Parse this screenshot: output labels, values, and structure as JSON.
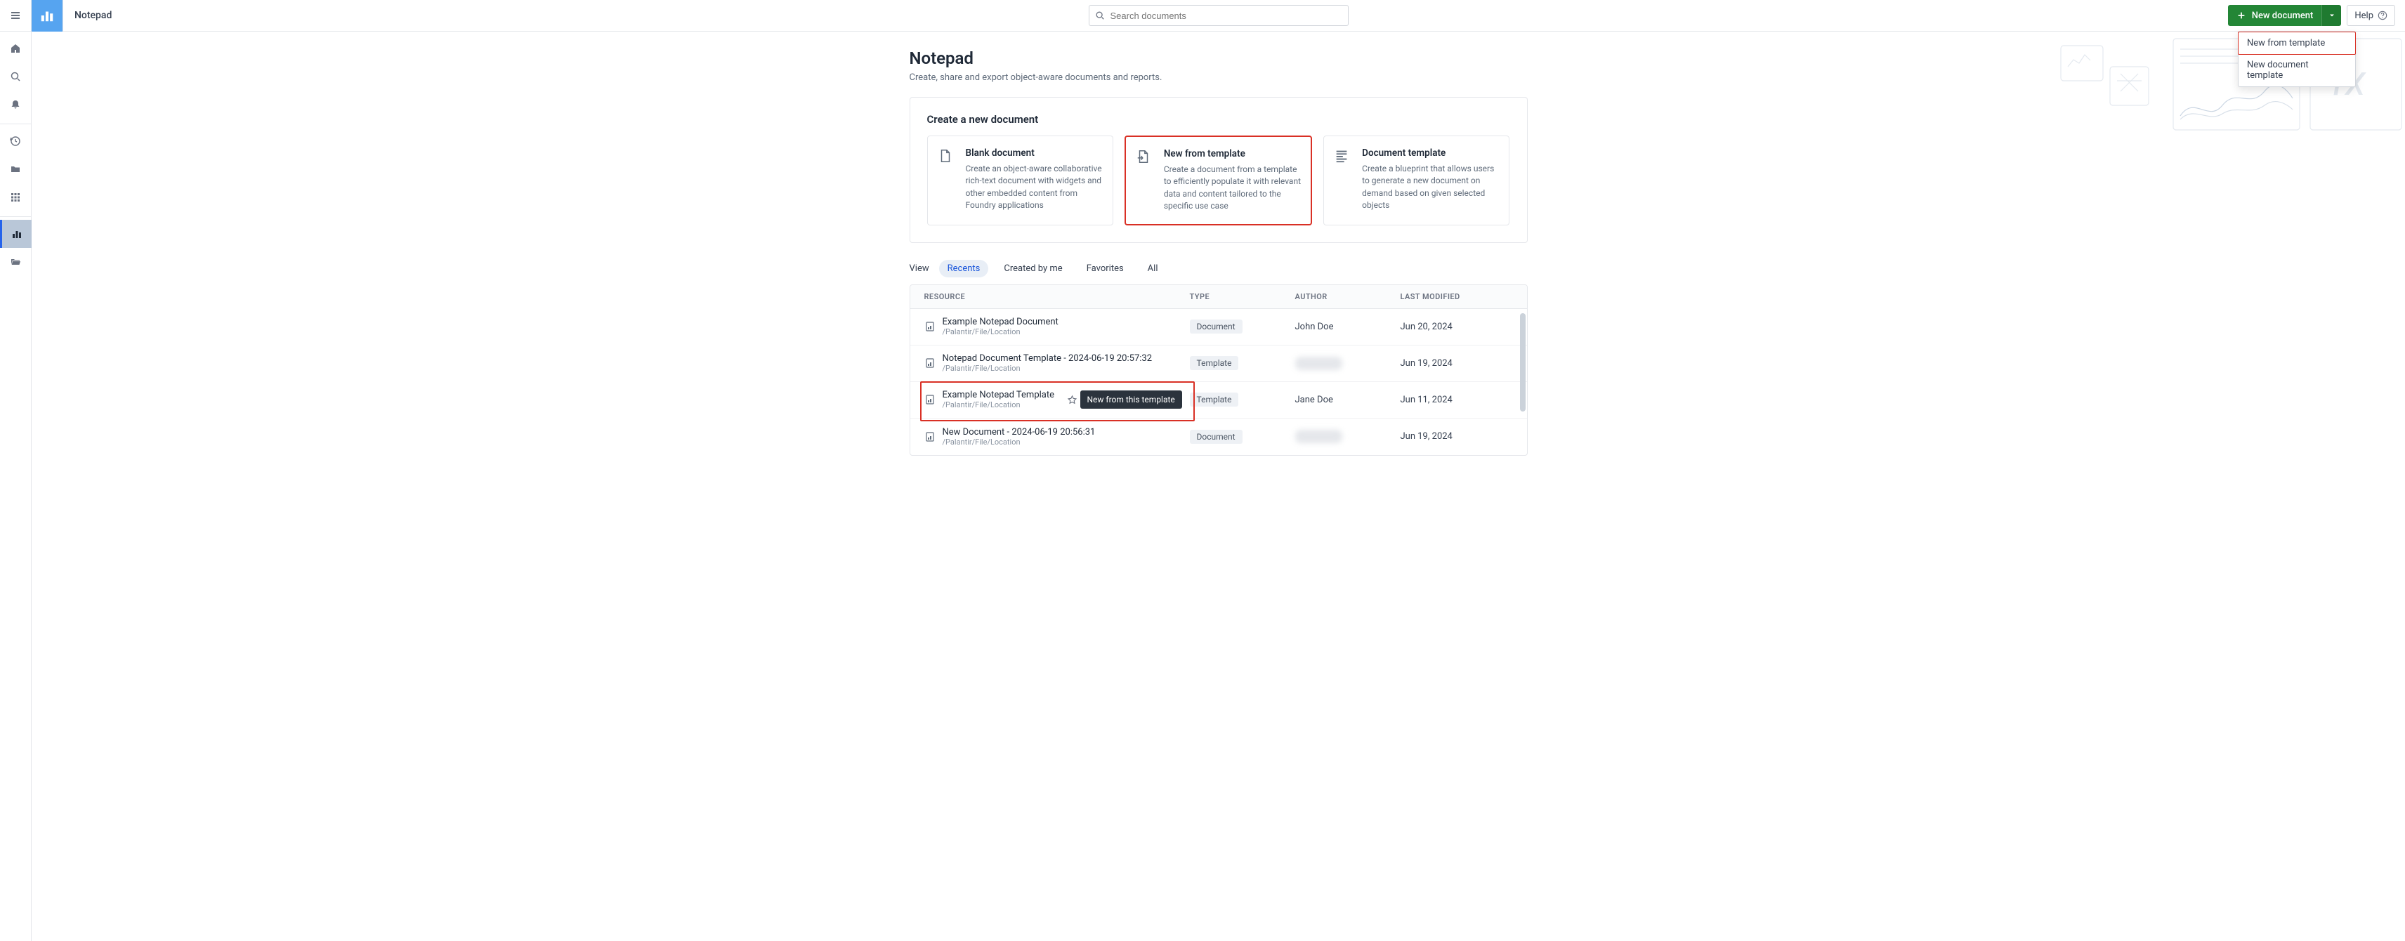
{
  "app": {
    "title": "Notepad"
  },
  "search": {
    "placeholder": "Search documents"
  },
  "buttons": {
    "new_document": "New document",
    "help": "Help"
  },
  "dropdown": {
    "items": [
      {
        "label": "New from template",
        "highlighted": true
      },
      {
        "label": "New document template",
        "highlighted": false
      }
    ]
  },
  "hero": {
    "title": "Notepad",
    "subtitle": "Create, share and export object-aware documents and reports."
  },
  "create_section": {
    "heading": "Create a new document",
    "options": [
      {
        "icon": "file-icon",
        "title": "Blank document",
        "desc": "Create an object-aware collaborative rich-text document with widgets and other embedded content from Foundry applications",
        "highlighted": false
      },
      {
        "icon": "file-import-icon",
        "title": "New from template",
        "desc": "Create a document from a template to efficiently populate it with relevant data and content tailored to the specific use case",
        "highlighted": true
      },
      {
        "icon": "template-lines-icon",
        "title": "Document template",
        "desc": "Create a blueprint that allows users to generate a new document on demand based on given selected objects",
        "highlighted": false
      }
    ]
  },
  "filters": {
    "label": "View",
    "chips": [
      {
        "label": "Recents",
        "active": true
      },
      {
        "label": "Created by me",
        "active": false
      },
      {
        "label": "Favorites",
        "active": false
      },
      {
        "label": "All",
        "active": false
      }
    ]
  },
  "table": {
    "headers": {
      "resource": "RESOURCE",
      "type": "TYPE",
      "author": "AUTHOR",
      "modified": "LAST MODIFIED"
    },
    "rows": [
      {
        "name": "Example Notepad Document",
        "path": "/Palantir/File/Location",
        "type": "Document",
        "author": "John Doe",
        "author_blurred": false,
        "modified": "Jun 20, 2024",
        "highlighted": false,
        "show_actions": false
      },
      {
        "name": "Notepad Document Template - 2024-06-19 20:57:32",
        "path": "/Palantir/File/Location",
        "type": "Template",
        "author": "hidden",
        "author_blurred": true,
        "modified": "Jun 19, 2024",
        "highlighted": false,
        "show_actions": false
      },
      {
        "name": "Example Notepad Template",
        "path": "/Palantir/File/Location",
        "type": "Template",
        "author": "Jane Doe",
        "author_blurred": false,
        "modified": "Jun 11, 2024",
        "highlighted": true,
        "show_actions": true,
        "tooltip": "New from this template"
      },
      {
        "name": "New Document - 2024-06-19 20:56:31",
        "path": "/Palantir/File/Location",
        "type": "Document",
        "author": "hidden",
        "author_blurred": true,
        "modified": "Jun 19, 2024",
        "highlighted": false,
        "show_actions": false
      }
    ]
  },
  "icons": {
    "hamburger": "hamburger-icon",
    "brand": "bar-chart-icon",
    "home": "home-icon",
    "search": "search-icon",
    "bell": "bell-icon",
    "clock": "clock-icon",
    "folder": "folder-icon",
    "apps": "apps-grid-icon",
    "chart_active": "bar-chart-icon",
    "folder_open": "open-folder-icon"
  }
}
